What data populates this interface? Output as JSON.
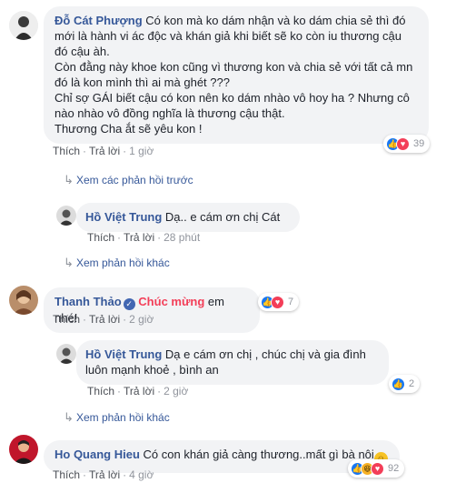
{
  "comments": [
    {
      "author": "Đỗ Cát Phượng",
      "text": "Có kon mà ko dám nhận và ko dám chia sẻ thì đó mới là hành vi ác độc và khán giả khi biết sẽ ko còn iu thương cậu đó cậu àh.\nCòn đằng này khoe kon cũng vì thương kon và chia sẻ với tất cả mn đó là kon mình thì ai mà ghét ???\nChỉ sợ GÁI biết cậu có kon nên ko dám nhào vô hoy ha ? Nhưng cô nào nhào vô đồng nghĩa là thương cậu thật.\nThương Cha ắt sẽ yêu kon !",
      "like": "Thích",
      "reply": "Trả lời",
      "time": "1 giờ",
      "reactions": [
        "like",
        "love"
      ],
      "count": "39"
    },
    {
      "author": "Hồ Việt Trung",
      "text": "Dạ.. e cám ơn chị Cát",
      "like": "Thích",
      "reply": "Trả lời",
      "time": "28 phút"
    },
    {
      "author": "Thanh Thảo",
      "highlight": "Chúc mừng",
      "text": "em nhé!",
      "like": "Thích",
      "reply": "Trả lời",
      "time": "2 giờ",
      "reactions": [
        "like",
        "love"
      ],
      "count": "7"
    },
    {
      "author": "Hồ Việt Trung",
      "text": "Dạ e cám ơn chị , chúc chị và gia đình luôn mạnh khoẻ , bình an",
      "like": "Thích",
      "reply": "Trả lời",
      "time": "2 giờ",
      "reactions": [
        "like"
      ],
      "count": "2"
    },
    {
      "author": "Ho Quang Hieu",
      "text": "Có con khán giả càng thương..mất gì bà nội",
      "like": "Thích",
      "reply": "Trả lời",
      "time": "4 giờ",
      "reactions": [
        "like",
        "haha",
        "love"
      ],
      "count": "92"
    }
  ],
  "links": {
    "previous_replies": "Xem các phản hồi trước",
    "other_replies_1": "Xem phản hồi khác",
    "other_replies_2": "Xem phản hồi khác"
  },
  "colors": {
    "link": "#365899",
    "bubble": "#f2f3f5",
    "like": "#1877f2",
    "love": "#f33e58",
    "haha": "#f7b125"
  }
}
